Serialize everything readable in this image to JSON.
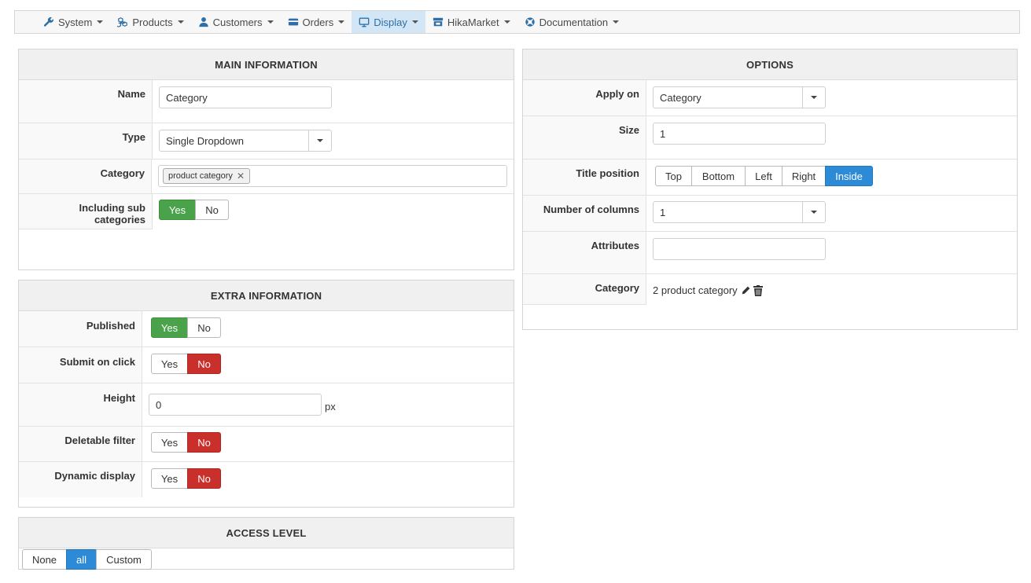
{
  "nav": {
    "items": [
      {
        "label": "System",
        "icon": "wrench-icon"
      },
      {
        "label": "Products",
        "icon": "cubes-icon"
      },
      {
        "label": "Customers",
        "icon": "user-icon"
      },
      {
        "label": "Orders",
        "icon": "credit-card-icon"
      },
      {
        "label": "Display",
        "icon": "monitor-icon"
      },
      {
        "label": "HikaMarket",
        "icon": "store-icon"
      },
      {
        "label": "Documentation",
        "icon": "lifebuoy-icon"
      }
    ],
    "active": "Display"
  },
  "main_info": {
    "title": "MAIN INFORMATION",
    "name_label": "Name",
    "name_value": "Category",
    "type_label": "Type",
    "type_value": "Single Dropdown",
    "category_label": "Category",
    "category_tag": "product category",
    "subcat_label": "Including sub categories",
    "subcat_yes": "Yes",
    "subcat_no": "No"
  },
  "extra_info": {
    "title": "EXTRA INFORMATION",
    "published_label": "Published",
    "submit_label": "Submit on click",
    "height_label": "Height",
    "height_value": "0",
    "height_unit": "px",
    "deletable_label": "Deletable filter",
    "dynamic_label": "Dynamic display",
    "yes": "Yes",
    "no": "No"
  },
  "access": {
    "title": "ACCESS LEVEL",
    "none": "None",
    "all": "all",
    "custom": "Custom"
  },
  "options": {
    "title": "OPTIONS",
    "apply_label": "Apply on",
    "apply_value": "Category",
    "size_label": "Size",
    "size_value": "1",
    "title_pos_label": "Title position",
    "positions": [
      "Top",
      "Bottom",
      "Left",
      "Right",
      "Inside"
    ],
    "columns_label": "Number of columns",
    "columns_value": "1",
    "attributes_label": "Attributes",
    "attributes_value": "",
    "category_label": "Category",
    "category_value": "2 product category"
  },
  "colors": {
    "green": "#4aa24a",
    "red": "#c9302c",
    "blue": "#2d8ad6"
  }
}
